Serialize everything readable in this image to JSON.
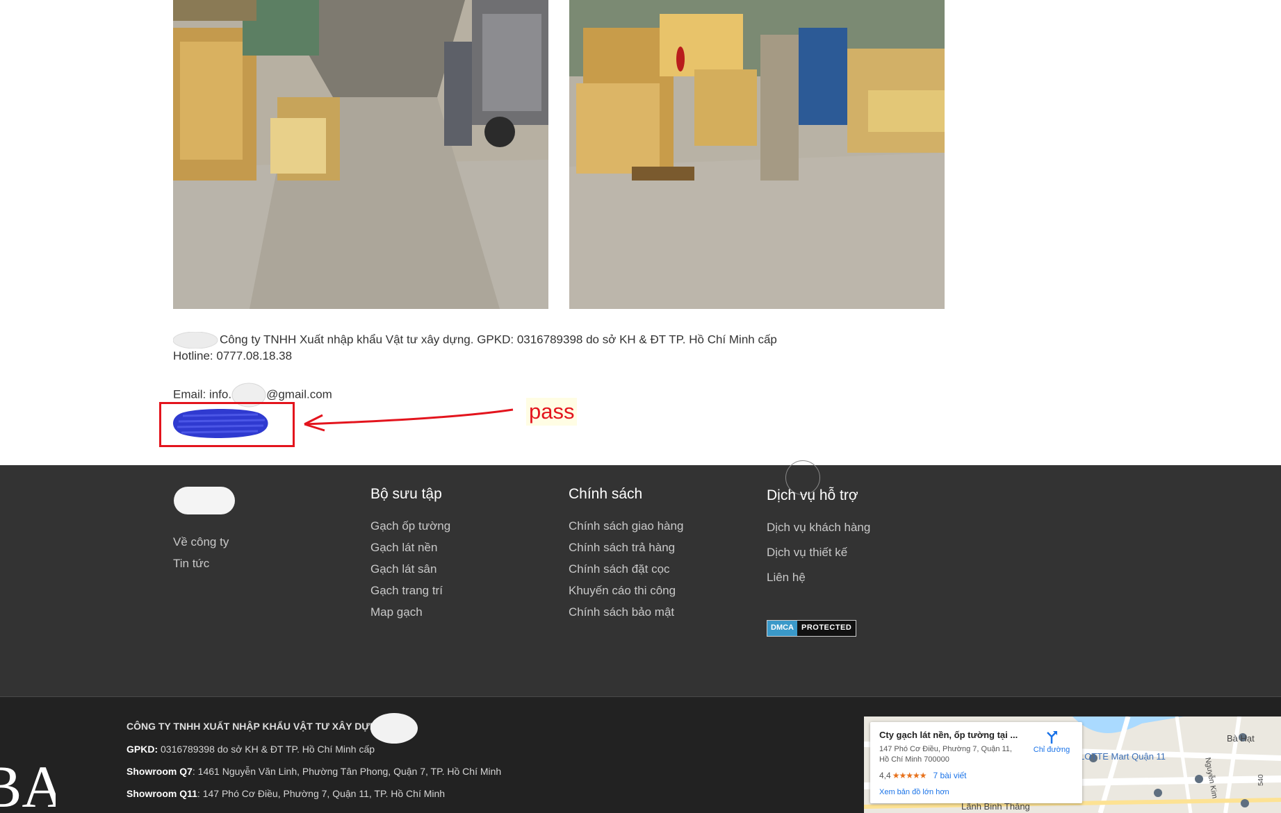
{
  "content": {
    "company_text": "Công ty TNHH Xuất nhập khẩu Vật tư xây dựng. GPKD: 0316789398 do sở KH & ĐT TP. Hồ Chí Minh cấp",
    "hotline_prefix": "Hotline: ",
    "hotline_number": "0777.08.18.38",
    "email_prefix": "Email: info.",
    "email_suffix": "@gmail.com",
    "annotation_label": "pass"
  },
  "footer": {
    "col1": {
      "items": [
        "Về công ty",
        "Tin tức"
      ]
    },
    "col2": {
      "title": "Bộ sưu tập",
      "items": [
        "Gạch ốp tường",
        "Gạch lát nền",
        "Gạch lát sân",
        "Gạch trang trí",
        "Map gạch"
      ]
    },
    "col3": {
      "title": "Chính sách",
      "items": [
        "Chính sách giao hàng",
        "Chính sách trả hàng",
        "Chính sách đặt cọc",
        "Khuyến cáo thi công",
        "Chính sách bảo mật"
      ]
    },
    "col4": {
      "title": "Dịch vụ hỗ trợ",
      "items": [
        "Dịch vụ khách hàng",
        "Dịch vụ thiết kế",
        "Liên hệ"
      ]
    },
    "dmca": {
      "left": "DMCA",
      "right": "PROTECTED"
    }
  },
  "footer_bottom": {
    "company": "CÔNG TY TNHH XUẤT NHẬP KHẨU VẬT TƯ XÂY DỰNG",
    "gpkd_label": "GPKD:",
    "gpkd_text": " 0316789398 do sở KH & ĐT TP. Hồ Chí Minh cấp",
    "q7_label": "Showroom Q7",
    "q7_text": ": 1461 Nguyễn Văn Linh, Phường Tân Phong, Quận 7, TP. Hồ Chí Minh",
    "q11_label": "Showroom Q11",
    "q11_text": ": 147 Phó Cơ Điều, Phường 7, Quận 11, TP. Hồ Chí Minh",
    "logo_fragment": "BA"
  },
  "map": {
    "title": "Cty gạch lát nền, ốp tường tại ...",
    "address": "147 Phó Cơ Điều, Phường 7, Quận 11, Hồ Chí Minh 700000",
    "rating": "4,4",
    "stars": "★★★★★",
    "reviews": "7 bài viết",
    "directions": "Chỉ đường",
    "larger_map": "Xem bản đồ lớn hơn",
    "labels": {
      "lotte": "LOTTE Mart Quận 11",
      "ba_hat": "Bà Hạt",
      "nguyen_kim": "Nguyễn Kim",
      "lanh_binh": "Lãnh Binh Thăng",
      "num": "540"
    }
  },
  "colors": {
    "footer_top": "#333333",
    "footer_bottom": "#222222",
    "annotation_red": "#e3141d",
    "scribble_blue": "#2f3ad0",
    "link_blue": "#1a73e8"
  }
}
